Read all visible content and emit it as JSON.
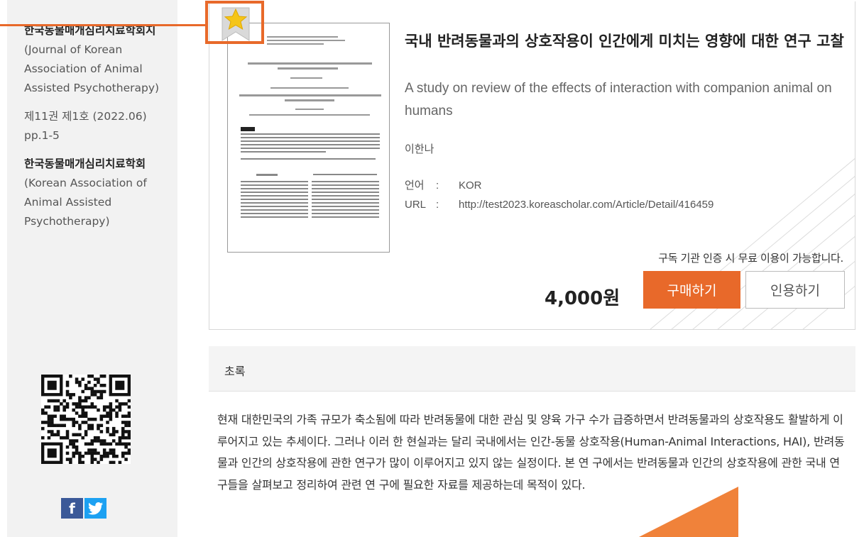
{
  "sidebar": {
    "journal_name": "한국동물매개심리치료학회지",
    "journal_name_en": "(Journal of Korean Association of Animal Assisted Psychotherapy)",
    "issue": "제11권 제1호 (2022.06)",
    "pages": "pp.1-5",
    "publisher": "한국동물매개심리치료학회",
    "publisher_en": "(Korean Association of Animal Assisted Psychotherapy)",
    "share": {
      "facebook": "f",
      "twitter": "twitter-icon"
    }
  },
  "article": {
    "title": "국내 반려동물과의 상호작용이 인간에게 미치는 영향에 대한 연구 고찰",
    "title_en": "A study on review of the effects of interaction with companion animal on humans",
    "author": "이한나",
    "language_label": "언어",
    "language": "KOR",
    "url_label": "URL",
    "url": "http://test2023.koreascholar.com/Article/Detail/416459",
    "separator": ":"
  },
  "purchase": {
    "notice": "구독 기관 인증 시 무료 이용이 가능합니다.",
    "price": "4,000원",
    "buy_label": "구매하기",
    "cite_label": "인용하기"
  },
  "abstract": {
    "label": "초록",
    "text": "현재 대한민국의 가족 규모가 축소됨에 따라 반려동물에 대한 관심 및 양육 가구 수가 급증하면서 반려동물과의 상호작용도 활발하게 이루어지고 있는 추세이다. 그러나 이러 한 현실과는 달리 국내에서는 인간-동물 상호작용(Human-Animal Interactions, HAI), 반려동물과 인간의 상호작용에 관한 연구가 많이 이루어지고 있지 않는 실정이다. 본 연 구에서는 반려동물과 인간의 상호작용에 관한 국내 연구들을 살펴보고 정리하여 관련 연 구에 필요한 자료를 제공하는데 목적이 있다."
  },
  "colors": {
    "accent": "#e8692a",
    "star": "#f5c518",
    "facebook": "#3b5998",
    "twitter": "#1da1f2"
  }
}
